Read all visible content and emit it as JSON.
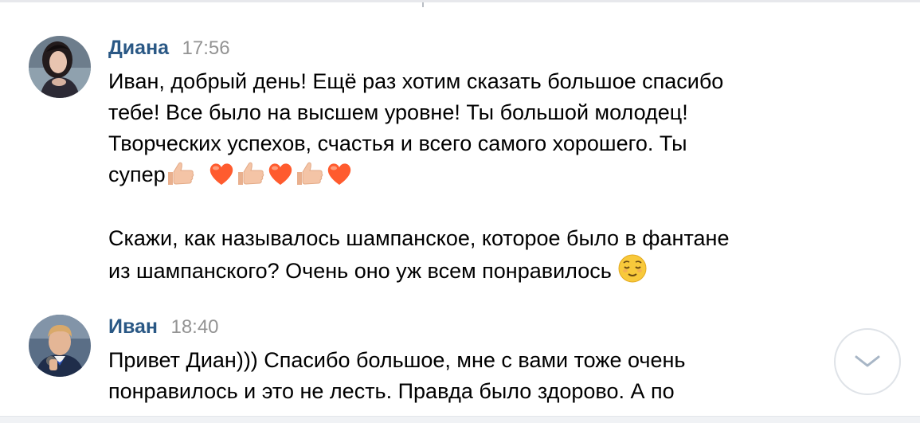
{
  "messages": [
    {
      "author": "Диана",
      "time": "17:56",
      "avatar_icon": "user-avatar-icon",
      "paragraphs": [
        {
          "lines": [
            "Иван, добрый день! Ещё раз хотим сказать большое спасибо",
            "тебе! Все было на высшем уровне! Ты большой молодец!",
            "Творческих успехов, счастья и всего самого хорошего. Ты"
          ],
          "last_line_text": "супер",
          "emojis": [
            "thumbs-up-icon",
            "heart-icon",
            "thumbs-up-icon",
            "heart-icon",
            "thumbs-up-icon",
            "heart-icon"
          ]
        },
        {
          "lines": [
            "Скажи, как называлось шампанское, которое было в фантане"
          ],
          "last_line_text": "из шампанского? Очень оно уж всем понравилось",
          "emojis": [
            "relieved-face-icon"
          ]
        }
      ]
    },
    {
      "author": "Иван",
      "time": "18:40",
      "avatar_icon": "user-avatar-icon",
      "paragraphs": [
        {
          "lines": [
            "Привет Диан))) Спасибо большое, мне с вами тоже очень",
            "понравилось и это не лесть. Правда было здорово. А по"
          ]
        }
      ]
    }
  ],
  "scroll_down_button": {
    "icon": "chevron-down-icon"
  },
  "colors": {
    "author": "#2a5885",
    "time": "#939393",
    "text": "#000000",
    "heart": "#ff5b2e",
    "thumb": "#f4c4a6"
  }
}
